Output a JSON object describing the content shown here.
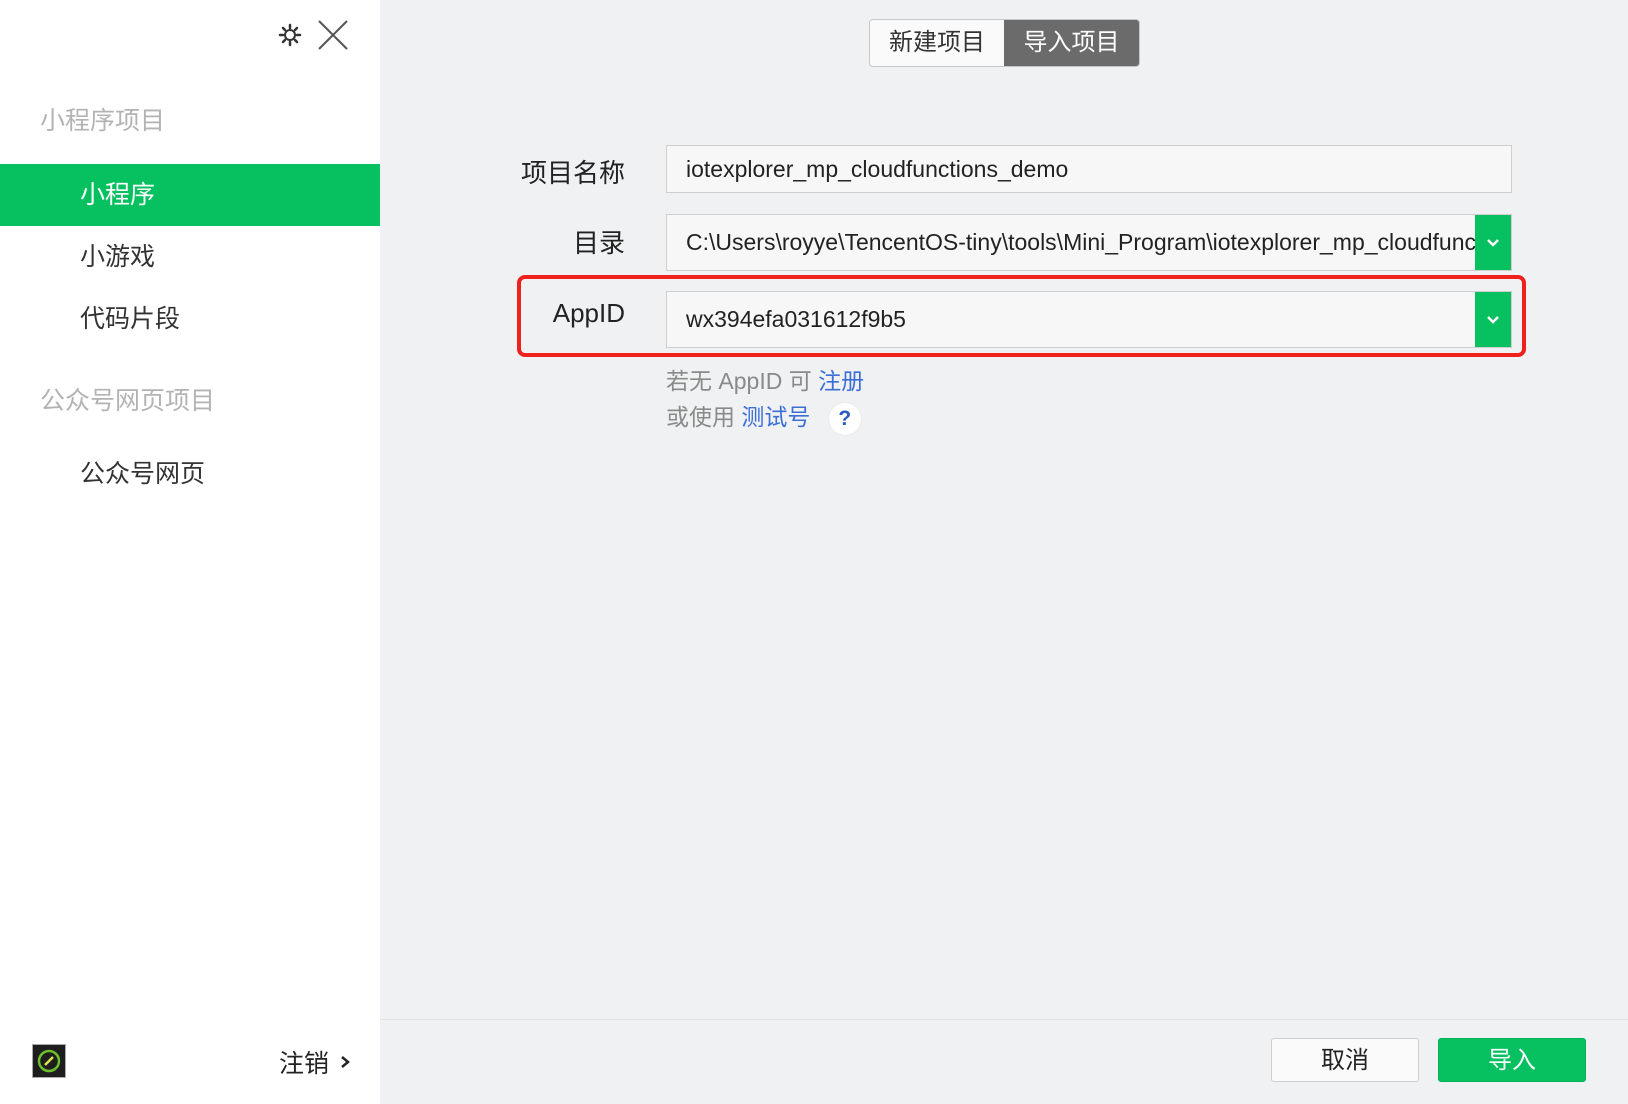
{
  "sidebar": {
    "section_mini": "小程序项目",
    "items_mini": [
      {
        "label": "小程序"
      },
      {
        "label": "小游戏"
      },
      {
        "label": "代码片段"
      }
    ],
    "section_official": "公众号网页项目",
    "items_official": [
      {
        "label": "公众号网页"
      }
    ],
    "logout_label": "注销",
    "icons": {
      "settings": "gear-icon",
      "close": "close-icon",
      "logout": "chevron-right-icon"
    }
  },
  "tabs": [
    {
      "label": "新建项目",
      "selected": false
    },
    {
      "label": "导入项目",
      "selected": true
    }
  ],
  "form": {
    "name_label": "项目名称",
    "name_value": "iotexplorer_mp_cloudfunctions_demo",
    "dir_label": "目录",
    "dir_value": "C:\\Users\\royye\\TencentOS-tiny\\tools\\Mini_Program\\iotexplorer_mp_cloudfunctions_demo",
    "appid_label": "AppID",
    "appid_value": "wx394efa031612f9b5"
  },
  "hints": {
    "no_appid_prefix": "若无 AppID 可",
    "register_link": "注册",
    "or_use_prefix": "或使用",
    "test_account_link": "测试号",
    "help_symbol": "?"
  },
  "footer": {
    "cancel_label": "取消",
    "import_label": "导入"
  },
  "colors": {
    "accent": "#07c160",
    "highlight": "#f0201c",
    "link": "#3c6fd6"
  }
}
